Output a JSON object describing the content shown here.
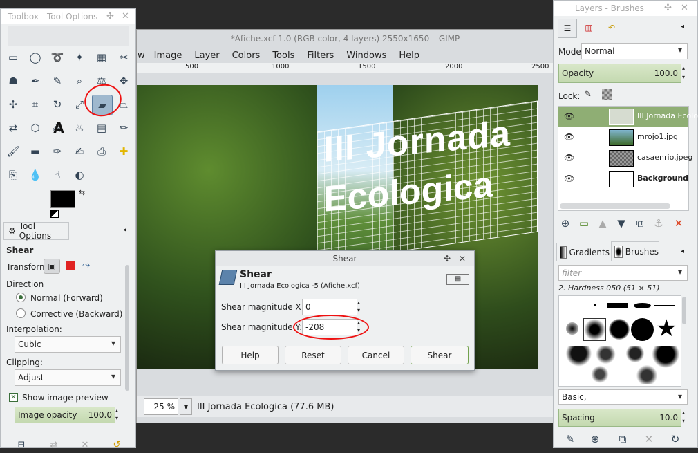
{
  "toolbox": {
    "title": "Toolbox - Tool Options",
    "pin": "✣",
    "close": "✕"
  },
  "tool_options": {
    "tab": "Tool Options",
    "heading": "Shear",
    "transform_label": "Transform:",
    "direction_label": "Direction",
    "normal": "Normal (Forward)",
    "corrective": "Corrective (Backward)",
    "interpolation_label": "Interpolation:",
    "interpolation": "Cubic",
    "clipping_label": "Clipping:",
    "clipping": "Adjust",
    "preview": "Show image preview",
    "opacity_label": "Image opacity",
    "opacity": "100.0"
  },
  "image_window": {
    "title": "*Afiche.xcf-1.0 (RGB color, 4 layers) 2550x1650 – GIMP",
    "menu": [
      "w",
      "Image",
      "Layer",
      "Colors",
      "Tools",
      "Filters",
      "Windows",
      "Help"
    ],
    "ruler": [
      "500",
      "1000",
      "1500",
      "2000",
      "2500"
    ],
    "canvas_text_1": "III Jornada",
    "canvas_text_2": "Ecologica",
    "zoom": "25 %",
    "status": "III Jornada Ecologica  (77.6 MB)"
  },
  "shear_dialog": {
    "title": "Shear",
    "heading": "Shear",
    "subtitle": "III Jornada Ecologica -5 (Afiche.xcf)",
    "x_label": "Shear magnitude X:",
    "x_value": "0",
    "y_label": "Shear magnitude Y:",
    "y_value": "-208",
    "help": "Help",
    "reset": "Reset",
    "cancel": "Cancel",
    "shear": "Shear"
  },
  "layers": {
    "title": "Layers - Brushes",
    "mode_label": "Mode:",
    "mode": "Normal",
    "opacity_label": "Opacity",
    "opacity": "100.0",
    "lock_label": "Lock:",
    "items": [
      "III Jornada Ecolo",
      "mrojo1.jpg",
      "casaenrio.jpeg",
      "Background"
    ]
  },
  "brushes": {
    "tab_gradients": "Gradients",
    "tab_brushes": "Brushes",
    "filter": "filter",
    "selected": "2. Hardness 050 (51 × 51)",
    "preset": "Basic,",
    "spacing_label": "Spacing",
    "spacing": "10.0"
  }
}
